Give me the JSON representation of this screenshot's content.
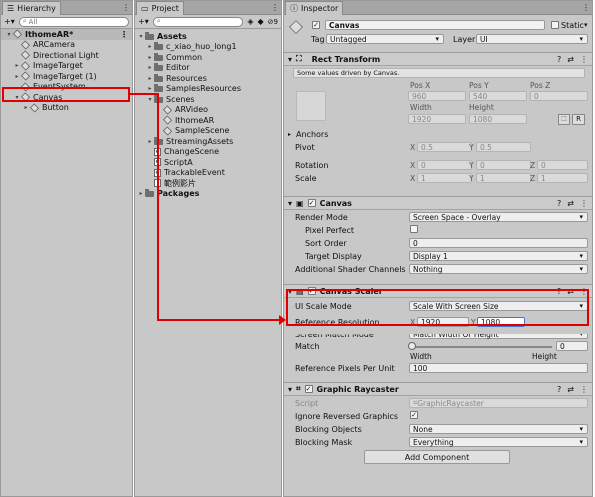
{
  "hierarchy": {
    "tab": "Hierarchy",
    "search_placeholder": "All",
    "scene": "IthomeAR*",
    "items": [
      {
        "label": "ARCamera",
        "depth": 2,
        "arrow": ""
      },
      {
        "label": "Directional Light",
        "depth": 2,
        "arrow": ""
      },
      {
        "label": "ImageTarget",
        "depth": 2,
        "arrow": "▸"
      },
      {
        "label": "ImageTarget (1)",
        "depth": 2,
        "arrow": "▸"
      },
      {
        "label": "EventSystem",
        "depth": 2,
        "arrow": ""
      },
      {
        "label": "Canvas",
        "depth": 2,
        "arrow": "▾"
      },
      {
        "label": "Button",
        "depth": 3,
        "arrow": "▸"
      }
    ]
  },
  "project": {
    "tab": "Project",
    "badge": "9",
    "items": [
      {
        "label": "Assets",
        "depth": 0,
        "arrow": "▾",
        "kind": "folder",
        "bold": true
      },
      {
        "label": "c_xiao_huo_long1",
        "depth": 1,
        "arrow": "▸",
        "kind": "folder"
      },
      {
        "label": "Common",
        "depth": 1,
        "arrow": "▸",
        "kind": "folder"
      },
      {
        "label": "Editor",
        "depth": 1,
        "arrow": "▸",
        "kind": "folder"
      },
      {
        "label": "Resources",
        "depth": 1,
        "arrow": "▸",
        "kind": "folder"
      },
      {
        "label": "SamplesResources",
        "depth": 1,
        "arrow": "▸",
        "kind": "folder"
      },
      {
        "label": "Scenes",
        "depth": 1,
        "arrow": "▾",
        "kind": "folder"
      },
      {
        "label": "ARVideo",
        "depth": 2,
        "arrow": "",
        "kind": "cube"
      },
      {
        "label": "IthomeAR",
        "depth": 2,
        "arrow": "",
        "kind": "cube"
      },
      {
        "label": "SampleScene",
        "depth": 2,
        "arrow": "",
        "kind": "cube"
      },
      {
        "label": "StreamingAssets",
        "depth": 1,
        "arrow": "▸",
        "kind": "folder"
      },
      {
        "label": "ChangeScene",
        "depth": 1,
        "arrow": "",
        "kind": "cs"
      },
      {
        "label": "ScriptA",
        "depth": 1,
        "arrow": "",
        "kind": "cs"
      },
      {
        "label": "TrackableEvent",
        "depth": 1,
        "arrow": "",
        "kind": "cs"
      },
      {
        "label": "範例影片",
        "depth": 1,
        "arrow": "",
        "kind": "file"
      },
      {
        "label": "Packages",
        "depth": 0,
        "arrow": "▸",
        "kind": "folder",
        "bold": true
      }
    ]
  },
  "inspector": {
    "tab": "Inspector",
    "object_name": "Canvas",
    "static_label": "Static",
    "tag_label": "Tag",
    "tag_value": "Untagged",
    "layer_label": "Layer",
    "layer_value": "UI",
    "rect": {
      "title": "Rect Transform",
      "note": "Some values driven by Canvas.",
      "posx_label": "Pos X",
      "posy_label": "Pos Y",
      "posz_label": "Pos Z",
      "posx": "960",
      "posy": "540",
      "posz": "0",
      "width_label": "Width",
      "height_label": "Height",
      "width": "1920",
      "height": "1080",
      "r_button": "R",
      "anchors_label": "Anchors",
      "pivot_label": "Pivot",
      "pivot_x": "0.5",
      "pivot_y": "0.5",
      "rotation_label": "Rotation",
      "rot_x": "0",
      "rot_y": "0",
      "rot_z": "0",
      "scale_label": "Scale",
      "scale_x": "1",
      "scale_y": "1",
      "scale_z": "1"
    },
    "canvas": {
      "title": "Canvas",
      "render_mode_label": "Render Mode",
      "render_mode": "Screen Space - Overlay",
      "pixel_perfect_label": "Pixel Perfect",
      "sort_order_label": "Sort Order",
      "sort_order": "0",
      "target_display_label": "Target Display",
      "target_display": "Display 1",
      "shader_channels_label": "Additional Shader Channels",
      "shader_channels": "Nothing"
    },
    "scaler": {
      "title": "Canvas Scaler",
      "ui_scale_mode_label": "UI Scale Mode",
      "ui_scale_mode": "Scale With Screen Size",
      "ref_res_label": "Reference Resolution",
      "ref_x": "1920",
      "ref_y": "1080",
      "screen_match_label": "Screen Match Mode",
      "screen_match": "Match Width Or Height",
      "match_label": "Match",
      "match_value": "0",
      "match_fraction": 0,
      "width_label": "Width",
      "height_label": "Height",
      "ppu_label": "Reference Pixels Per Unit",
      "ppu": "100"
    },
    "raycaster": {
      "title": "Graphic Raycaster",
      "script_label": "Script",
      "script_value": "GraphicRaycaster",
      "ignore_label": "Ignore Reversed Graphics",
      "blocking_objects_label": "Blocking Objects",
      "blocking_objects": "None",
      "blocking_mask_label": "Blocking Mask",
      "blocking_mask": "Everything"
    },
    "add_component": "Add Component"
  },
  "colors": {
    "highlight": "#e00000",
    "panel": "#c8c8c8"
  }
}
